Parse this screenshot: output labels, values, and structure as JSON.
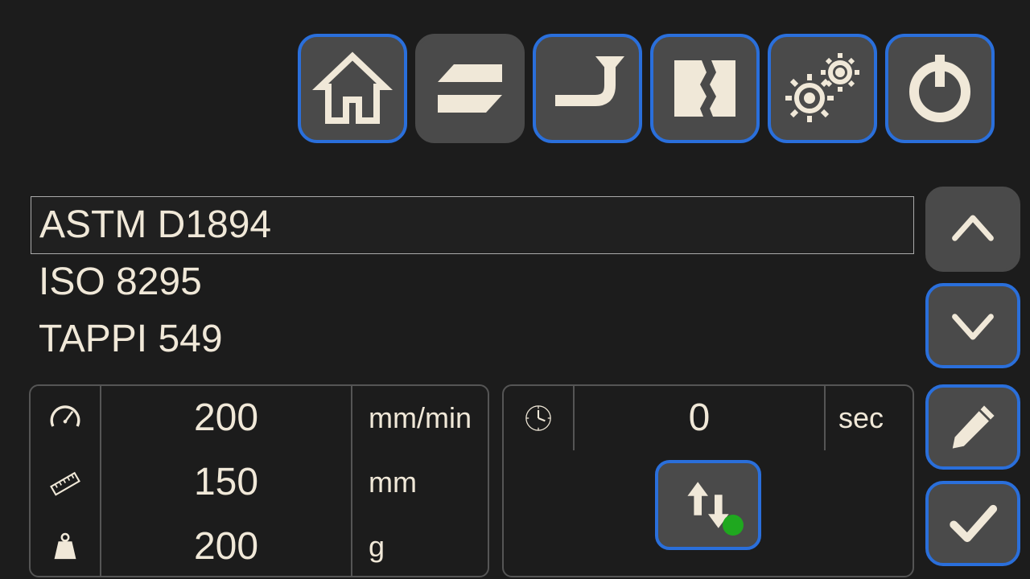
{
  "nav": {
    "items": [
      {
        "name": "home"
      },
      {
        "name": "transfer"
      },
      {
        "name": "peel"
      },
      {
        "name": "tear"
      },
      {
        "name": "settings"
      },
      {
        "name": "power"
      }
    ]
  },
  "methods": {
    "items": [
      {
        "label": "ASTM D1894",
        "selected": true
      },
      {
        "label": "ISO 8295",
        "selected": false
      },
      {
        "label": "TAPPI 549",
        "selected": false
      }
    ]
  },
  "params": {
    "speed": {
      "value": "200",
      "unit": "mm/min"
    },
    "length": {
      "value": "150",
      "unit": "mm"
    },
    "weight": {
      "value": "200",
      "unit": "g"
    }
  },
  "time": {
    "value": "0",
    "unit": "sec"
  }
}
